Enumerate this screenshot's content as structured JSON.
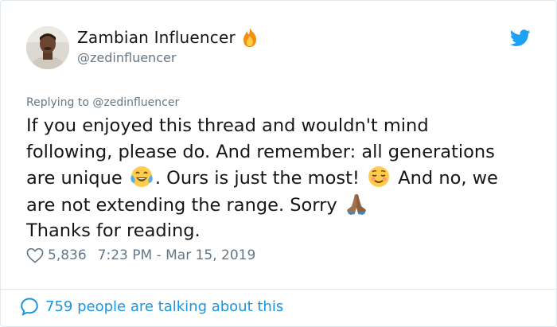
{
  "author": {
    "display_name": "Zambian Influencer",
    "handle": "@zedinfluencer",
    "name_emoji": "fire-icon",
    "avatar": "avatar"
  },
  "platform_icon": "twitter-bird-icon",
  "reply": {
    "text": "Replying to @zedinfluencer"
  },
  "tweet": {
    "line1": "If you enjoyed this thread and wouldn't mind",
    "line2": "following, please do. And remember: all generations",
    "line3a": "are unique",
    "line3b": ". Ours is just the most!",
    "line3c": "And no, we",
    "line4a": "are not extending the range. Sorry",
    "line5": "Thanks for reading.",
    "emojis": [
      "tears-of-joy-emoji",
      "relieved-face-emoji",
      "folded-hands-emoji"
    ]
  },
  "meta": {
    "likes": "5,836",
    "timestamp": "7:23 PM - Mar 15, 2019"
  },
  "footer": {
    "talking": "759 people are talking about this"
  },
  "colors": {
    "accent": "#1b95e0",
    "muted": "#657786",
    "text": "#14171a",
    "border": "#e1e8ed"
  }
}
